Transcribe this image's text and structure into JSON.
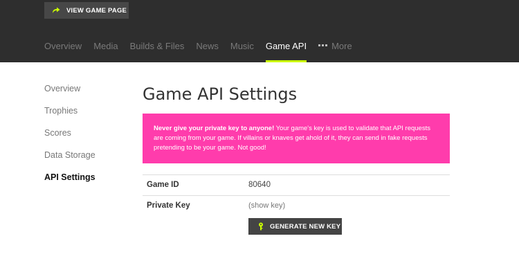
{
  "header": {
    "view_game_page_label": "VIEW GAME PAGE",
    "tabs": [
      "Overview",
      "Media",
      "Builds & Files",
      "News",
      "Music",
      "Game API"
    ],
    "active_tab": "Game API",
    "more_label": "More"
  },
  "sidebar": {
    "items": [
      "Overview",
      "Trophies",
      "Scores",
      "Data Storage",
      "API Settings"
    ],
    "active": "API Settings"
  },
  "main": {
    "title": "Game API Settings",
    "alert": {
      "bold": "Never give your private key to anyone!",
      "text": " Your game's key is used to validate that API requests are coming from your game. If villains or knaves get ahold of it, they can send in fake requests pretending to be your game. Not good!"
    },
    "fields": [
      {
        "label": "Game ID",
        "value": "80640"
      },
      {
        "label": "Private Key",
        "value": "(show key)"
      }
    ],
    "generate_label": "GENERATE NEW KEY"
  },
  "colors": {
    "header_bg": "#2e2e2e",
    "accent": "#ccff00",
    "alert_bg": "#ff3cac",
    "button_bg": "#444444"
  },
  "icons": {
    "view_game_page": "arrow-right-icon",
    "more": "dots-icon",
    "generate": "key-icon"
  }
}
